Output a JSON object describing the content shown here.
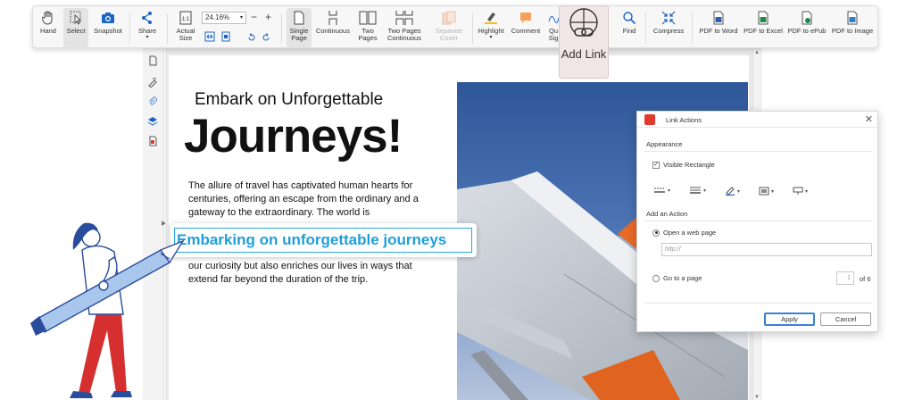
{
  "toolbar": {
    "hand": "Hand",
    "select": "Select",
    "snapshot": "Snapshot",
    "share": "Share",
    "actual_size": "Actual Size",
    "zoom_value": "24.16%",
    "zoom_out": "−",
    "zoom_in": "+",
    "single_page": "Single Page",
    "continuous": "Continuous",
    "two_pages": "Two Pages",
    "two_pages_continuous": "Two Pages Continuous",
    "separate_cover": "Separate Cover",
    "highlight": "Highlight",
    "comment": "Comment",
    "quick_sign": "Qu Sig",
    "find": "Find",
    "compress": "Compress",
    "pdf_to_word": "PDF to Word",
    "pdf_to_excel": "PDF to Excel",
    "pdf_to_epub": "PDF to ePub",
    "pdf_to_image": "PDF to Image"
  },
  "add_link": {
    "label": "Add Link"
  },
  "document": {
    "subtitle": "Embark on Unforgettable",
    "title": "Journeys!",
    "paragraph_1": "The allure of travel has captivated human hearts for centuries, offering an escape from the ordinary and a gateway to the extraordinary. The world is",
    "paragraph_2": "our curiosity but also enriches our lives in ways that extend far beyond the duration of the trip.",
    "link_text": "Embarking on unforgettable journeys"
  },
  "dialog": {
    "title": "Link Actions",
    "appearance": "Appearance",
    "visible_rectangle": "Visible Rectangle",
    "add_action": "Add an Action",
    "open_web_page": "Open a web page",
    "url_placeholder": "http://",
    "go_to_page": "Go to a page",
    "page_value": "1",
    "page_total": "of 6",
    "apply": "Apply",
    "cancel": "Cancel"
  },
  "colors": {
    "accent": "#2aa8e0",
    "brand_red": "#e13b2f",
    "toolbar_bg": "#f7f7f7"
  }
}
